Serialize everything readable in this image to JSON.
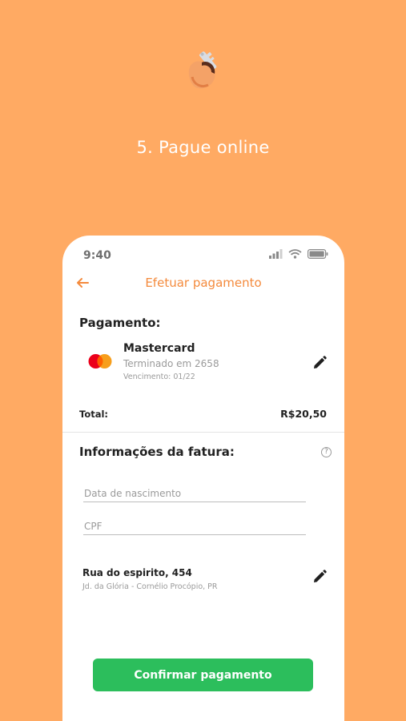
{
  "step": {
    "title": "5. Pague online",
    "icon": "key-in-lock-icon"
  },
  "status_bar": {
    "time": "9:40",
    "icons": [
      "signal-icon",
      "wifi-icon",
      "battery-icon"
    ]
  },
  "header": {
    "title": "Efetuar pagamento",
    "back_icon": "back-arrow-icon"
  },
  "payment": {
    "heading": "Pagamento:",
    "card": {
      "brand": "Mastercard",
      "ending": "Terminado em 2658",
      "expiry": "Vencimento: 01/22"
    },
    "total_label": "Total:",
    "total_value": "R$20,50"
  },
  "invoice": {
    "heading": "Informações da fatura:",
    "fields": {
      "birthdate": {
        "placeholder": "Data de nascimento",
        "value": ""
      },
      "cpf": {
        "placeholder": "CPF",
        "value": ""
      }
    },
    "address": {
      "line1": "Rua do espirito, 454",
      "line2": "Jd. da Glória - Cornélio Procópio, PR"
    }
  },
  "actions": {
    "confirm_label": "Confirmar pagamento"
  },
  "colors": {
    "background": "#FFAA63",
    "accent": "#F48A3C",
    "confirm": "#2CBE5C",
    "mastercard_red": "#EB001B",
    "mastercard_orange": "#F79E1B"
  }
}
